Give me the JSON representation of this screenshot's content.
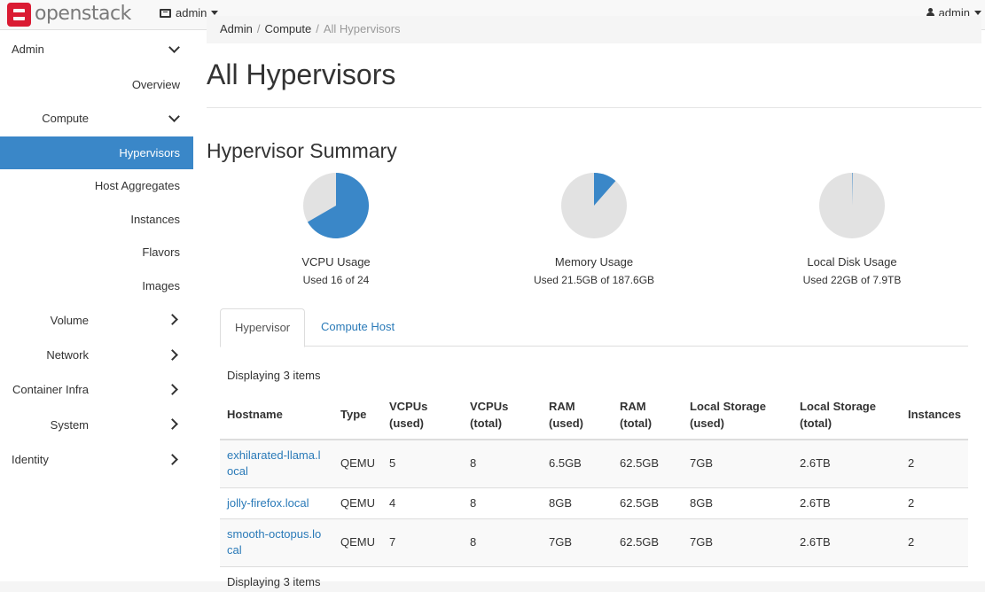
{
  "brand": {
    "name": "openstack",
    "accent": "#da1a32"
  },
  "header": {
    "project": "admin",
    "user": "admin"
  },
  "sidebar": {
    "active_color": "#3a87c8",
    "admin": "Admin",
    "overview": "Overview",
    "compute": "Compute",
    "hypervisors": "Hypervisors",
    "host_aggregates": "Host Aggregates",
    "instances": "Instances",
    "flavors": "Flavors",
    "images": "Images",
    "volume": "Volume",
    "network": "Network",
    "container_infra": "Container Infra",
    "system": "System",
    "identity": "Identity"
  },
  "breadcrumb": {
    "items": [
      "Admin",
      "Compute"
    ],
    "current": "All Hypervisors"
  },
  "page_title": "All Hypervisors",
  "summary": {
    "title": "Hypervisor Summary",
    "colors": {
      "used": "#3a87c8",
      "free": "#e2e2e2"
    },
    "charts": [
      {
        "label": "VCPU Usage",
        "sub": "Used 16 of 24",
        "used_fraction": 0.6667
      },
      {
        "label": "Memory Usage",
        "sub": "Used 21.5GB of 187.6GB",
        "used_fraction": 0.1146
      },
      {
        "label": "Local Disk Usage",
        "sub": "Used 22GB of 7.9TB",
        "used_fraction": 0.0027
      }
    ]
  },
  "tabs": {
    "hypervisor": "Hypervisor",
    "compute_host": "Compute Host"
  },
  "table": {
    "count_text": "Displaying 3 items",
    "headers": {
      "hostname": "Hostname",
      "type": "Type",
      "vcpus_used": "VCPUs (used)",
      "vcpus_total": "VCPUs (total)",
      "ram_used": "RAM (used)",
      "ram_total": "RAM (total)",
      "storage_used": "Local Storage (used)",
      "storage_total": "Local Storage (total)",
      "instances": "Instances"
    },
    "rows": [
      {
        "hostname": "exhilarated-llama.local",
        "type": "QEMU",
        "vcpus_used": "5",
        "vcpus_total": "8",
        "ram_used": "6.5GB",
        "ram_total": "62.5GB",
        "storage_used": "7GB",
        "storage_total": "2.6TB",
        "instances": "2"
      },
      {
        "hostname": "jolly-firefox.local",
        "type": "QEMU",
        "vcpus_used": "4",
        "vcpus_total": "8",
        "ram_used": "8GB",
        "ram_total": "62.5GB",
        "storage_used": "8GB",
        "storage_total": "2.6TB",
        "instances": "2"
      },
      {
        "hostname": "smooth-octopus.local",
        "type": "QEMU",
        "vcpus_used": "7",
        "vcpus_total": "8",
        "ram_used": "7GB",
        "ram_total": "62.5GB",
        "storage_used": "7GB",
        "storage_total": "2.6TB",
        "instances": "2"
      }
    ]
  }
}
